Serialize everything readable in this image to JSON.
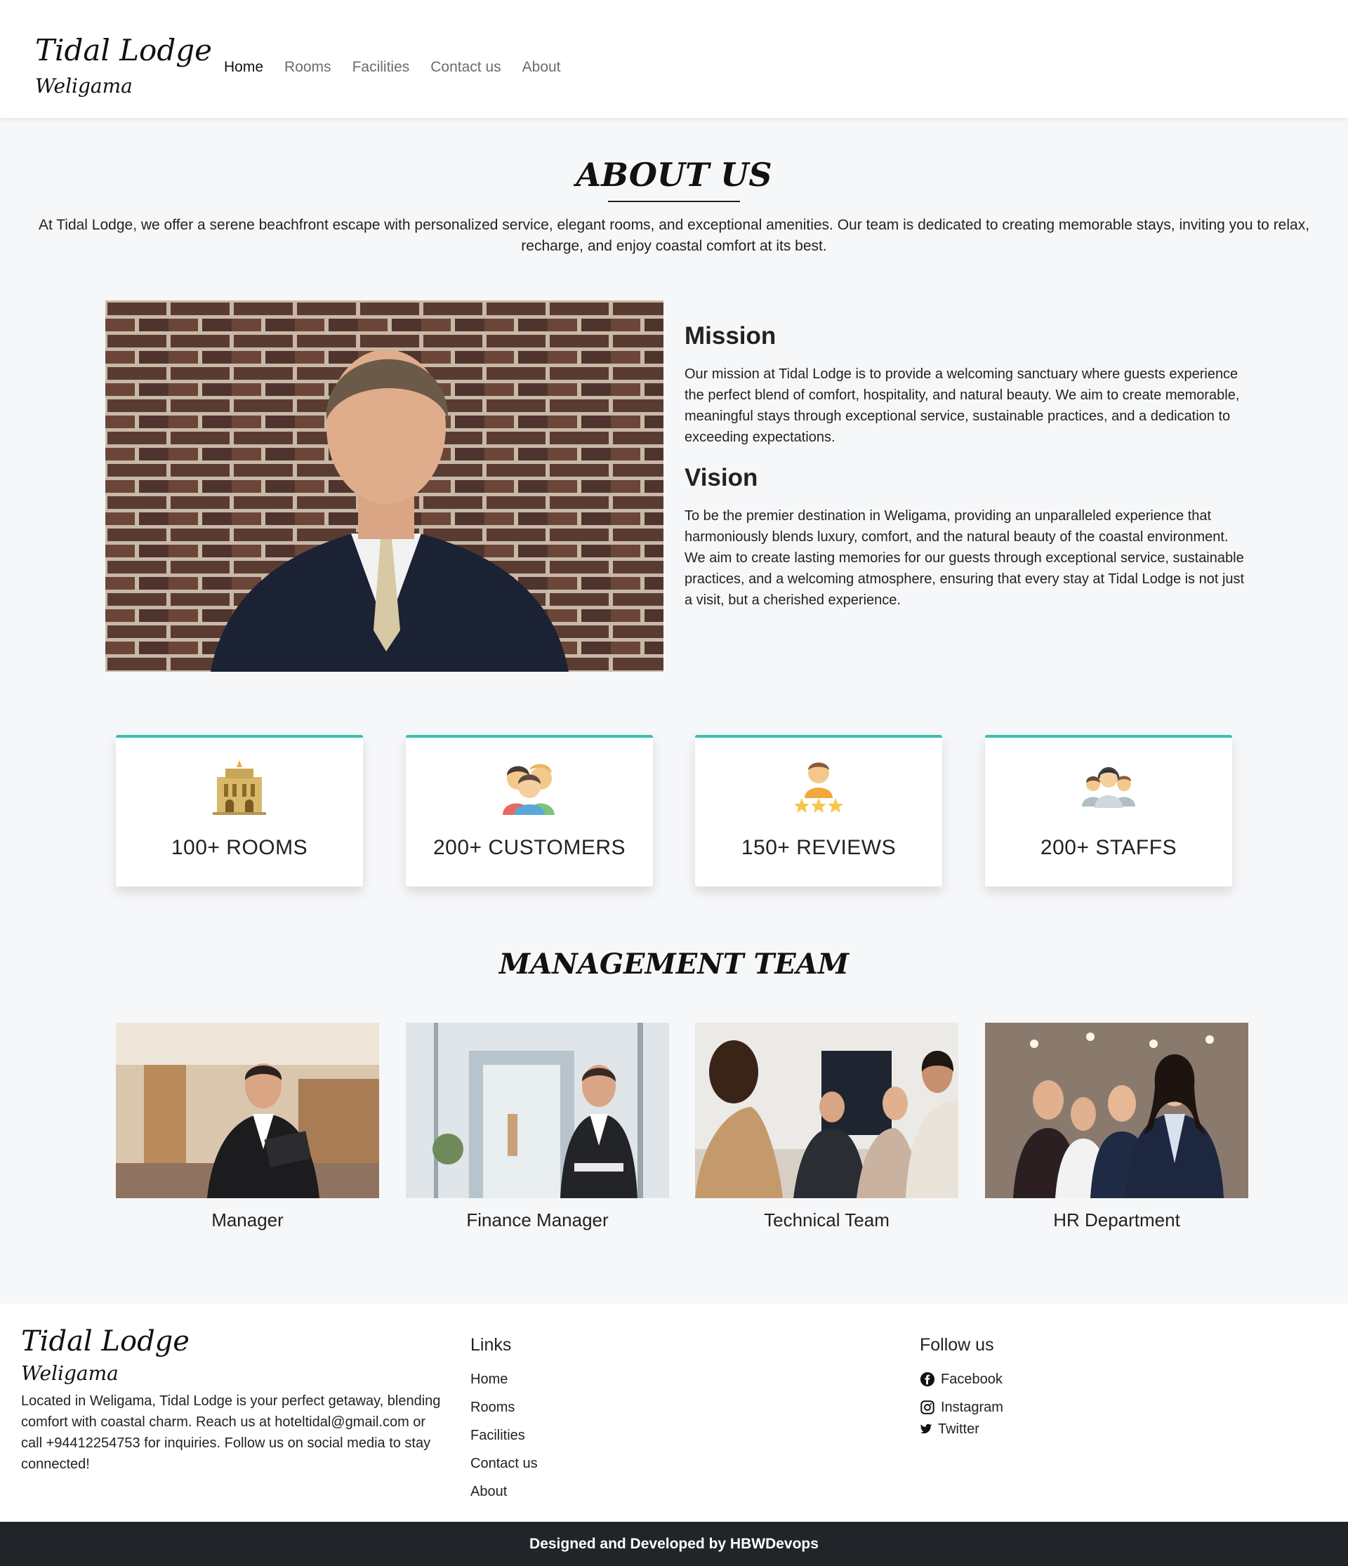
{
  "brand": {
    "title": "Tidal Lodge",
    "subtitle": "Weligama"
  },
  "nav": {
    "items": [
      {
        "label": "Home",
        "active": true
      },
      {
        "label": "Rooms",
        "active": false
      },
      {
        "label": "Facilities",
        "active": false
      },
      {
        "label": "Contact us",
        "active": false
      },
      {
        "label": "About",
        "active": false
      }
    ]
  },
  "about": {
    "title": "ABOUT US",
    "intro": "At Tidal Lodge, we offer a serene beachfront escape with personalized service, elegant rooms, and exceptional amenities. Our team is dedicated to creating memorable stays, inviting you to relax, recharge, and enjoy coastal comfort at its best.",
    "mission": {
      "heading": "Mission",
      "text": "Our mission at Tidal Lodge is to provide a welcoming sanctuary where guests experience the perfect blend of comfort, hospitality, and natural beauty. We aim to create memorable, meaningful stays through exceptional service, sustainable practices, and a dedication to exceeding expectations."
    },
    "vision": {
      "heading": "Vision",
      "text": "To be the premier destination in Weligama, providing an unparalleled experience that harmoniously blends luxury, comfort, and the natural beauty of the coastal environment. We aim to create lasting memories for our guests through exceptional service, sustainable practices, and a welcoming atmosphere, ensuring that every stay at Tidal Lodge is not just a visit, but a cherished experience."
    }
  },
  "stats": [
    {
      "label": "100+ ROOMS",
      "icon": "hotel-building-icon"
    },
    {
      "label": "200+ CUSTOMERS",
      "icon": "customers-group-icon"
    },
    {
      "label": "150+ REVIEWS",
      "icon": "rating-stars-icon"
    },
    {
      "label": "200+ STAFFS",
      "icon": "staff-team-icon"
    }
  ],
  "team": {
    "title": "MANAGEMENT TEAM",
    "members": [
      {
        "label": "Manager"
      },
      {
        "label": "Finance Manager"
      },
      {
        "label": "Technical Team"
      },
      {
        "label": "HR Department"
      }
    ]
  },
  "footer": {
    "brand_title": "Tidal Lodge",
    "brand_subtitle": "Weligama",
    "description": "Located in Weligama, Tidal Lodge is your perfect getaway, blending comfort with coastal charm. Reach us at hoteltidal@gmail.com or call +94412254753 for inquiries. Follow us on social media to stay connected!",
    "links_heading": "Links",
    "links": [
      "Home",
      "Rooms",
      "Facilities",
      "Contact us",
      "About"
    ],
    "follow_heading": "Follow us",
    "social": [
      {
        "label": "Facebook",
        "icon": "facebook-icon"
      },
      {
        "label": "Instagram",
        "icon": "instagram-icon"
      },
      {
        "label": "Twitter",
        "icon": "twitter-icon"
      }
    ]
  },
  "copyright": "Designed and Developed by HBWDevops",
  "colors": {
    "accent": "#3cbfae",
    "footer_bar": "#212429",
    "page_bg": "#f6f7f9"
  }
}
